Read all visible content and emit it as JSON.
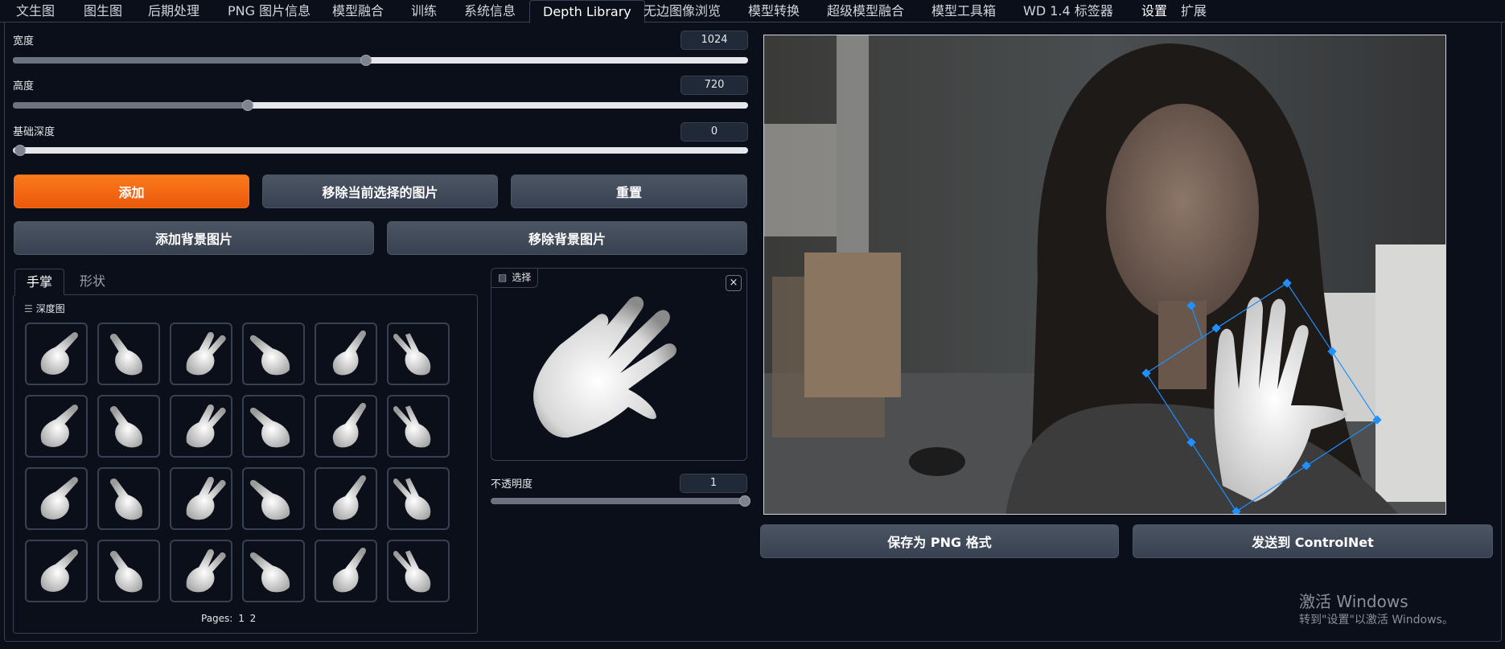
{
  "tabs": [
    "文生图",
    "图生图",
    "后期处理",
    "PNG 图片信息",
    "模型融合",
    "训练",
    "系统信息",
    "Depth Library",
    "无边图像浏览",
    "模型转换",
    "超级模型融合",
    "模型工具箱",
    "WD 1.4 标签器",
    "设置",
    "扩展"
  ],
  "active_tab": "Depth Library",
  "sliders": {
    "width": {
      "label": "宽度",
      "value": "1024",
      "fraction": 0.48
    },
    "height": {
      "label": "高度",
      "value": "720",
      "fraction": 0.32
    },
    "base_depth": {
      "label": "基础深度",
      "value": "0",
      "fraction": 0.0
    },
    "opacity": {
      "label": "不透明度",
      "value": "1",
      "fraction": 1.0
    }
  },
  "buttons": {
    "add": "添加",
    "remove_selected": "移除当前选择的图片",
    "reset": "重置",
    "add_background": "添加背景图片",
    "remove_background": "移除背景图片",
    "save_png": "保存为 PNG 格式",
    "send_controlnet": "发送到 ControlNet"
  },
  "library": {
    "tabs": [
      "手掌",
      "形状"
    ],
    "active_tab": "手掌",
    "gallery_label": "深度图",
    "pages_label": "Pages:",
    "pages": [
      "1",
      "2"
    ],
    "thumbnail_count": 24
  },
  "selection": {
    "label": "选择",
    "close": "×"
  },
  "watermark": {
    "line1": "激活 Windows",
    "line2": "转到\"设置\"以激活 Windows。"
  }
}
